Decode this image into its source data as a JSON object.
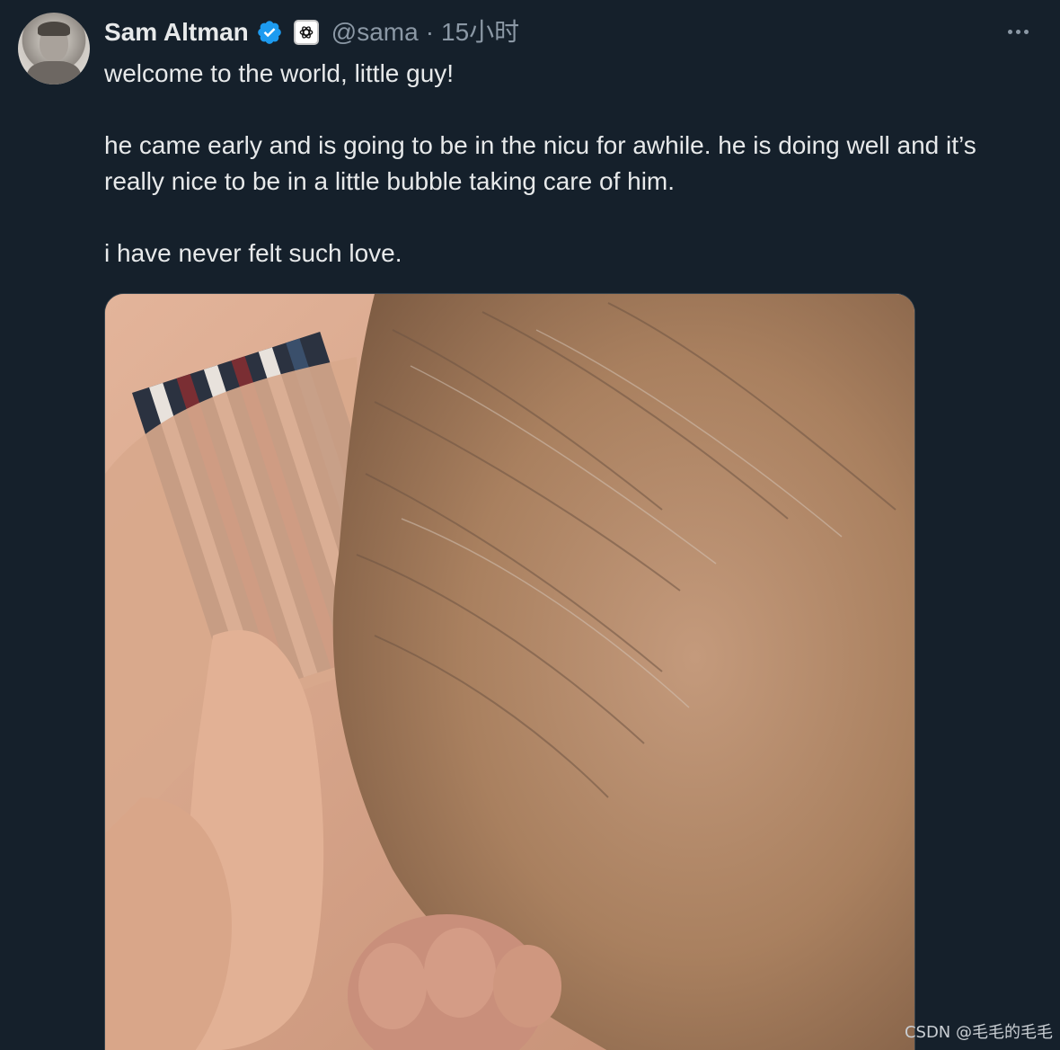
{
  "tweet": {
    "author_name": "Sam Altman",
    "handle": "@sama",
    "separator": "·",
    "time": "15小时",
    "lines": [
      "welcome to the world, little guy!",
      "he came early and is going to be in the nicu for awhile. he is doing well and it’s really nice to be in a little bubble taking care of him.",
      "i have never felt such love."
    ]
  },
  "icons": {
    "verified": "verified-badge-icon",
    "affiliate": "openai-logo-icon",
    "more": "more-options-icon"
  },
  "watermark": "CSDN @毛毛的毛毛",
  "colors": {
    "background": "#15202b",
    "text": "#e7e9ea",
    "secondary_text": "#8b98a5",
    "verified_blue": "#1d9bf0"
  }
}
